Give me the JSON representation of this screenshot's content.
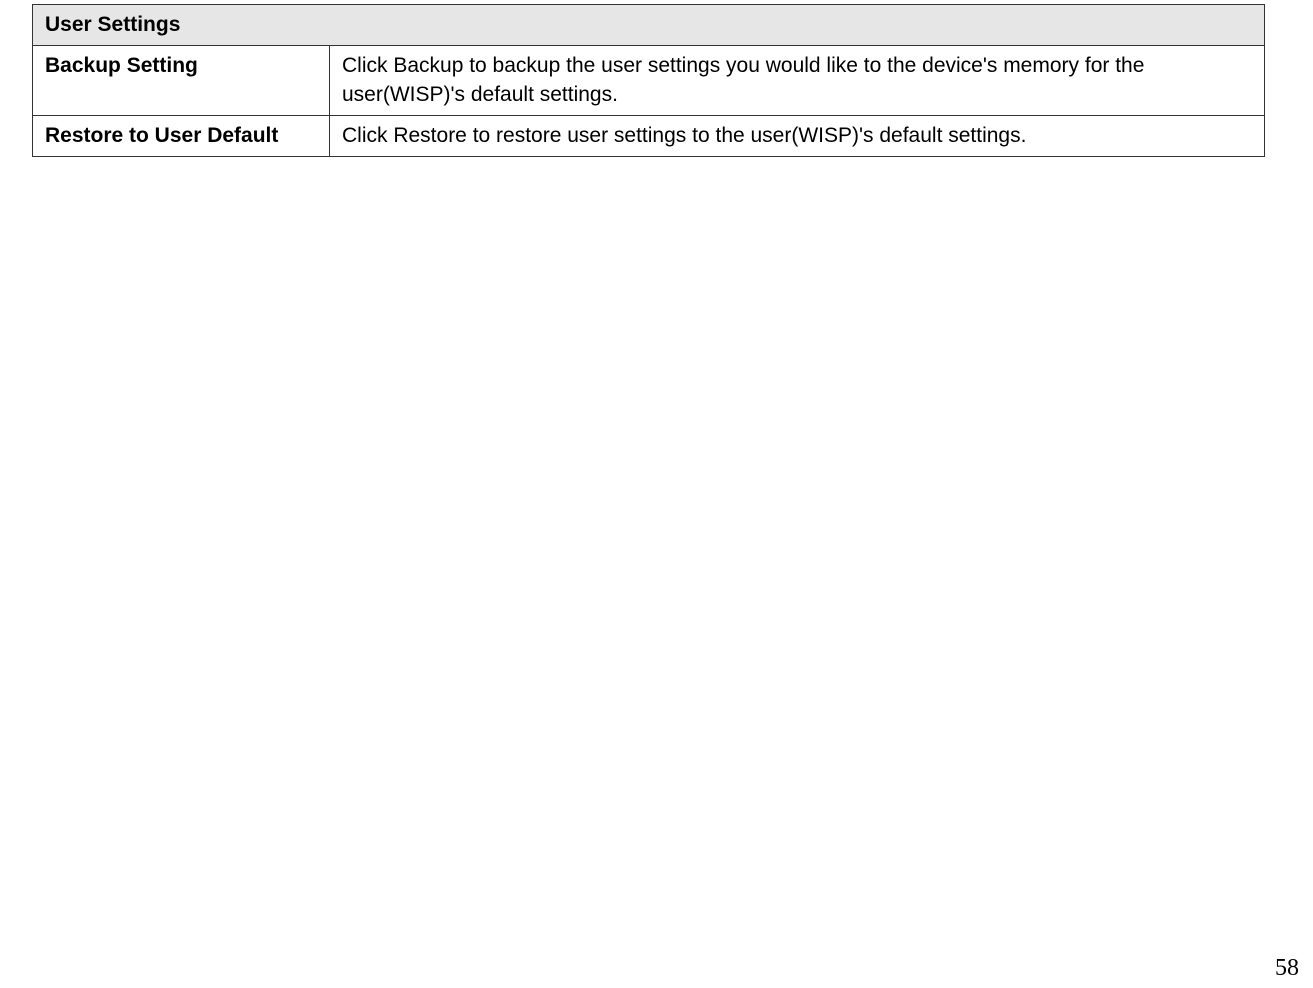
{
  "table": {
    "section_header": "User Settings",
    "rows": [
      {
        "label": "Backup Setting",
        "desc": "Click Backup to backup the user settings you would like to the device's memory for the user(WISP)'s default settings."
      },
      {
        "label": "Restore to User Default",
        "desc": "Click Restore to restore user settings to the user(WISP)'s default settings."
      }
    ]
  },
  "page_number": "58"
}
